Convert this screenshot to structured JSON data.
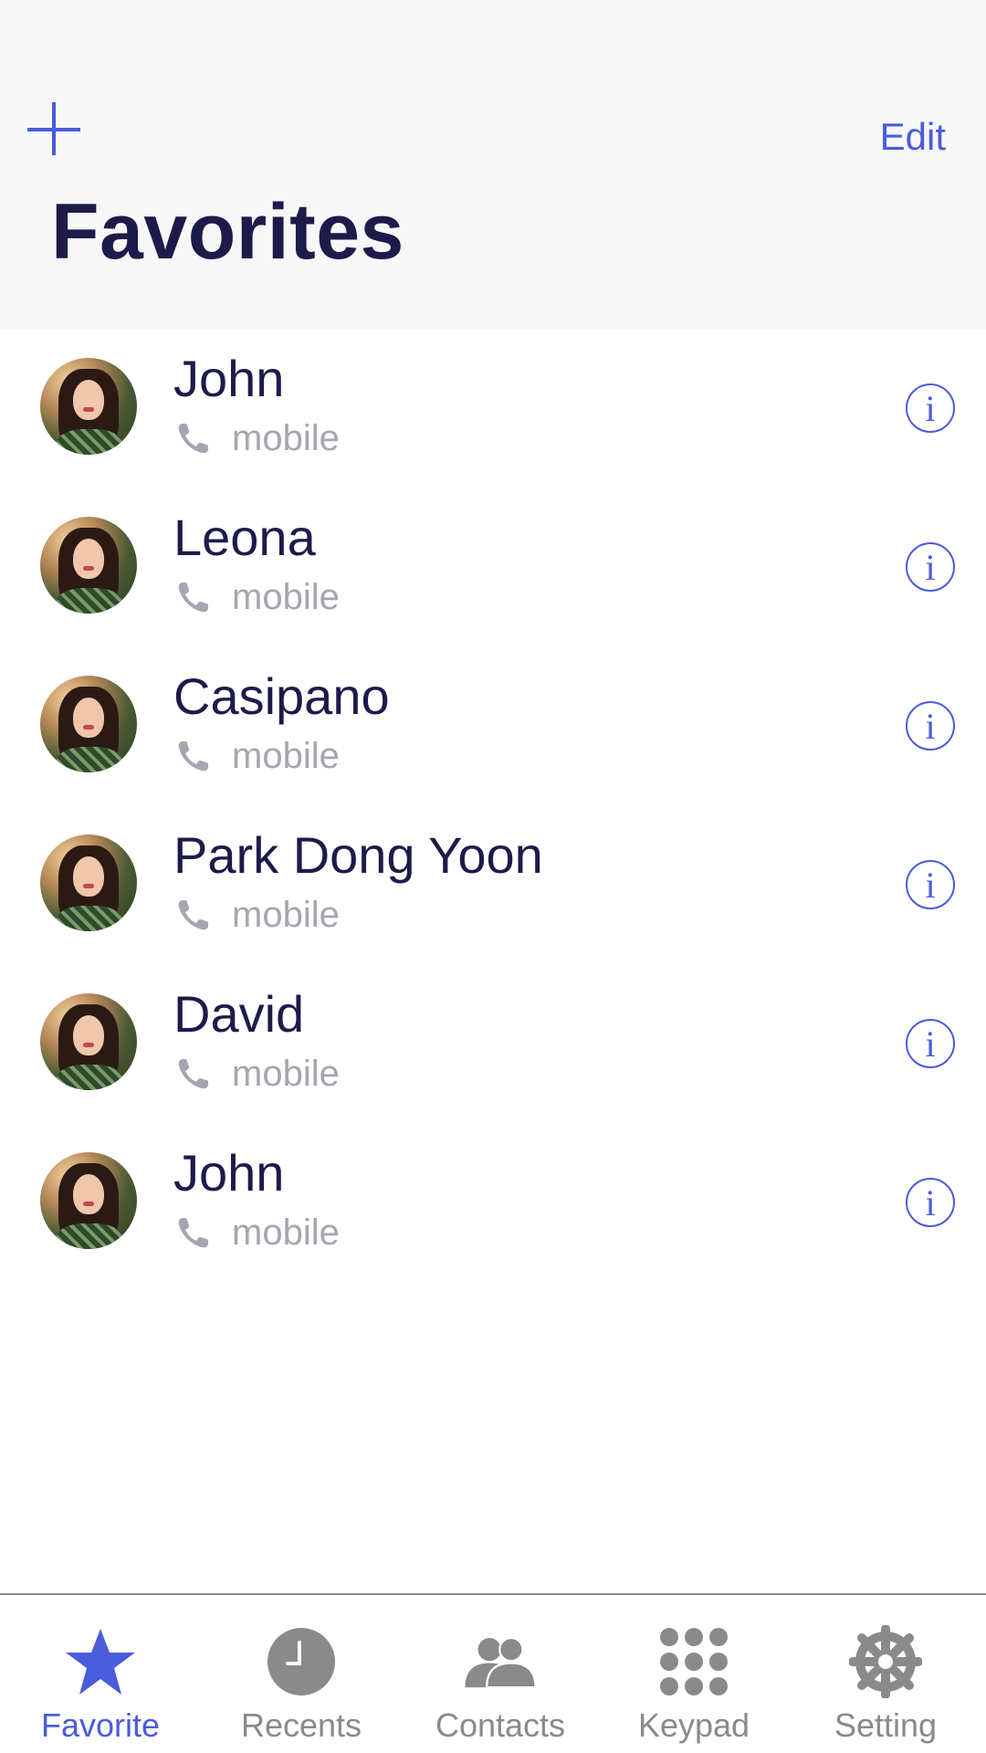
{
  "header": {
    "add_icon": "plus-icon",
    "edit_label": "Edit",
    "title": "Favorites"
  },
  "contacts": [
    {
      "name": "John",
      "type": "mobile"
    },
    {
      "name": "Leona",
      "type": "mobile"
    },
    {
      "name": "Casipano",
      "type": "mobile"
    },
    {
      "name": "Park Dong Yoon",
      "type": "mobile"
    },
    {
      "name": "David",
      "type": "mobile"
    },
    {
      "name": "John",
      "type": "mobile"
    }
  ],
  "info_glyph": "i",
  "tabs": [
    {
      "label": "Favorite",
      "icon": "star-icon",
      "active": true
    },
    {
      "label": "Recents",
      "icon": "clock-icon",
      "active": false
    },
    {
      "label": "Contacts",
      "icon": "contacts-icon",
      "active": false
    },
    {
      "label": "Keypad",
      "icon": "keypad-icon",
      "active": false
    },
    {
      "label": "Setting",
      "icon": "gear-icon",
      "active": false
    }
  ],
  "colors": {
    "accent": "#4a5bdc",
    "title": "#1d1b4a",
    "secondary_text": "#a4a6b0",
    "inactive_tab": "#8a8a8a",
    "header_bg": "#f7f7f7"
  }
}
